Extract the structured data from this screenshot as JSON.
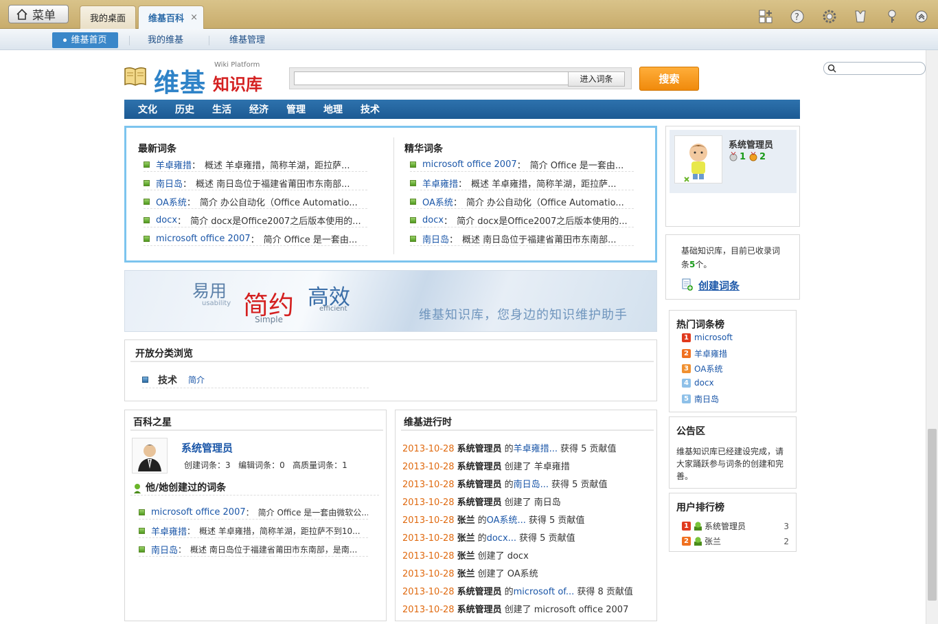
{
  "topbar": {
    "menu_label": "菜单",
    "tabs": [
      {
        "label": "我的桌面"
      },
      {
        "label": "维基百科",
        "close": "×"
      }
    ],
    "icons": [
      "add-widget-icon",
      "help-icon",
      "settings-icon",
      "skin-icon",
      "key-icon",
      "collapse-icon"
    ]
  },
  "subnav": {
    "items": [
      {
        "label": "维基首页"
      },
      {
        "label": "我的维基"
      },
      {
        "label": "维基管理"
      }
    ]
  },
  "logo": {
    "title_blue": "维基",
    "title_red": "知识库",
    "subtitle": "Wiki Platform"
  },
  "search": {
    "placeholder": "",
    "enter_label": "进入词条",
    "search_label": "搜索"
  },
  "categories": [
    "文化",
    "历史",
    "生活",
    "经济",
    "管理",
    "地理",
    "技术"
  ],
  "latest": {
    "title": "最新词条",
    "items": [
      {
        "name": "羊卓雍措",
        "desc": "概述 羊卓雍措，简称羊湖，距拉萨..."
      },
      {
        "name": "南日岛",
        "desc": "概述 南日岛位于福建省莆田市东南部..."
      },
      {
        "name": "OA系统",
        "desc": "简介 办公自动化（Office Automatio..."
      },
      {
        "name": "docx",
        "desc": "简介 docx是Office2007之后版本使用的..."
      },
      {
        "name": "microsoft office 2007",
        "desc": "简介 Office 是一套由..."
      }
    ]
  },
  "featured": {
    "title": "精华词条",
    "items": [
      {
        "name": "microsoft office 2007",
        "desc": "简介 Office 是一套由..."
      },
      {
        "name": "羊卓雍措",
        "desc": "概述 羊卓雍措，简称羊湖，距拉萨..."
      },
      {
        "name": "OA系统",
        "desc": "简介 办公自动化（Office Automatio..."
      },
      {
        "name": "docx",
        "desc": "简介 docx是Office2007之后版本使用的..."
      },
      {
        "name": "南日岛",
        "desc": "概述 南日岛位于福建省莆田市东南部..."
      }
    ]
  },
  "banner": {
    "w1": "易用",
    "w1_en": "usability",
    "w2": "简约",
    "w2_en": "Simple",
    "w3": "高效",
    "w3_en": "efficient",
    "slogan": "维基知识库，您身边的知识维护助手"
  },
  "open_cat": {
    "title": "开放分类浏览",
    "item": "技术",
    "link": "简介"
  },
  "star": {
    "title": "百科之星",
    "name": "系统管理员",
    "stats": "创建词条：3   编辑词条：0   高质量词条：1",
    "created_title": "他/她创建过的词条",
    "items": [
      {
        "name": "microsoft office 2007",
        "desc": "简介 Office 是一套由微软公..."
      },
      {
        "name": "羊卓雍措",
        "desc": "概述 羊卓雍措，简称羊湖，距拉萨不到10..."
      },
      {
        "name": "南日岛",
        "desc": "概述 南日岛位于福建省莆田市东南部，是南..."
      }
    ]
  },
  "activity": {
    "title": "维基进行时",
    "items": [
      {
        "date": "2013-10-28",
        "user": "系统管理员",
        "pre": "的",
        "link": "羊卓雍措...",
        "post": "获得 5 贡献值"
      },
      {
        "date": "2013-10-28",
        "user": "系统管理员",
        "pre": "创建了 羊卓雍措",
        "link": "",
        "post": ""
      },
      {
        "date": "2013-10-28",
        "user": "系统管理员",
        "pre": "的",
        "link": "南日岛...",
        "post": "获得 5 贡献值"
      },
      {
        "date": "2013-10-28",
        "user": "系统管理员",
        "pre": "创建了 南日岛",
        "link": "",
        "post": ""
      },
      {
        "date": "2013-10-28",
        "user": "张兰",
        "pre": "的",
        "link": "OA系统...",
        "post": "获得 5 贡献值"
      },
      {
        "date": "2013-10-28",
        "user": "张兰",
        "pre": "的",
        "link": "docx...",
        "post": "获得 5 贡献值"
      },
      {
        "date": "2013-10-28",
        "user": "张兰",
        "pre": "创建了 docx",
        "link": "",
        "post": ""
      },
      {
        "date": "2013-10-28",
        "user": "张兰",
        "pre": "创建了 OA系统",
        "link": "",
        "post": ""
      },
      {
        "date": "2013-10-28",
        "user": "系统管理员",
        "pre": "的",
        "link": "microsoft of...",
        "post": "获得 8 贡献值"
      },
      {
        "date": "2013-10-28",
        "user": "系统管理员",
        "pre": "创建了 microsoft office 2007",
        "link": "",
        "post": ""
      }
    ]
  },
  "profile": {
    "name": "系统管理员",
    "medal1": "1",
    "medal2": "2"
  },
  "kb_info": {
    "text1": "基础知识库，目前已收录词",
    "text2_pre": "条",
    "count": "5",
    "text2_post": "个。",
    "create_label": "创建词条"
  },
  "hot": {
    "title": "热门词条榜",
    "items": [
      "microsoft",
      "羊卓雍措",
      "OA系统",
      "docx",
      "南日岛"
    ],
    "ranks": [
      "1",
      "2",
      "3",
      "4",
      "5"
    ],
    "colors": [
      "#e03a1e",
      "#f07020",
      "#f09030",
      "#8ec0e8",
      "#8ec0e8"
    ]
  },
  "notice": {
    "title": "公告区",
    "text": "维基知识库已经建设完成，请大家踊跃参与词条的创建和完善。"
  },
  "user_rank": {
    "title": "用户排行榜",
    "items": [
      {
        "rank": "1",
        "name": "系统管理员",
        "score": "3"
      },
      {
        "rank": "2",
        "name": "张兰",
        "score": "2"
      }
    ]
  }
}
